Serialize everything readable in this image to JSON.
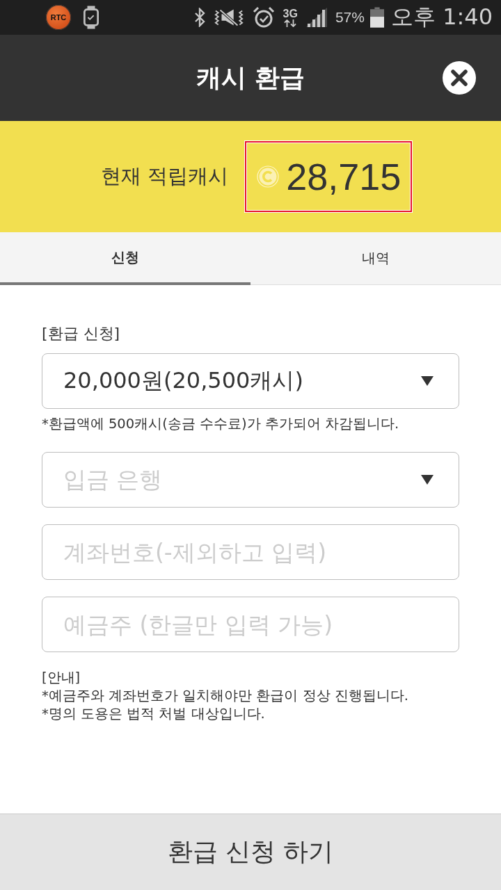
{
  "status_bar": {
    "logo_text": "RTC",
    "network": "3G",
    "battery": "57%",
    "time": "오후 1:40"
  },
  "header": {
    "title": "캐시 환급"
  },
  "balance": {
    "label": "현재 적립캐시",
    "amount": "28,715"
  },
  "tabs": [
    {
      "label": "신청",
      "selected": true
    },
    {
      "label": "내역",
      "selected": false
    }
  ],
  "form": {
    "section_title": "[환급 신청]",
    "fields": [
      {
        "kind": "select",
        "value": "20,000원(20,500캐시)",
        "note": "*환급액에 500캐시(송금 수수료)가 추가되어 차감됩니다."
      },
      {
        "kind": "select",
        "placeholder": "입금 은행"
      },
      {
        "kind": "text",
        "placeholder": "계좌번호(-제외하고 입력)"
      },
      {
        "kind": "text",
        "placeholder": "예금주 (한글만 입력 가능)"
      }
    ]
  },
  "guide": {
    "title": "[안내]",
    "lines": [
      "*예금주와 계좌번호가 일치해야만 환급이 정상 진행됩니다.",
      "*명의 도용은 법적 처벌 대상입니다."
    ]
  },
  "submit_button": {
    "label": "환급 신청 하기"
  }
}
